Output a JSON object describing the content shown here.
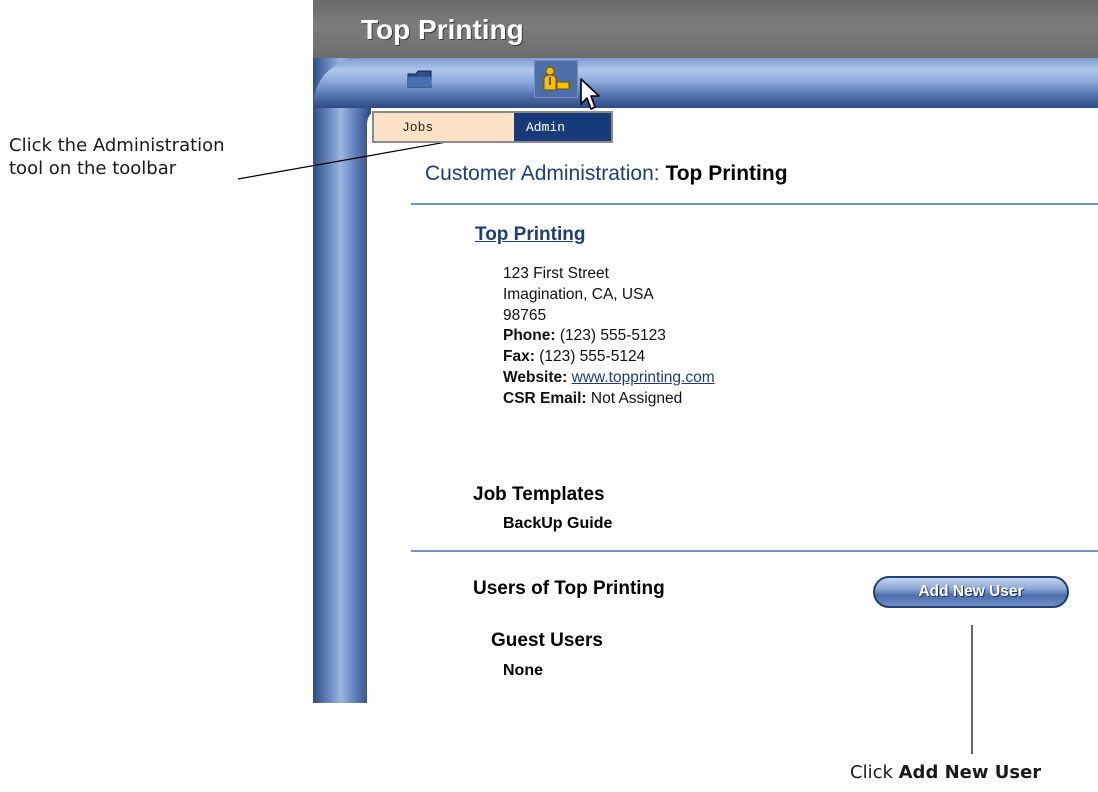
{
  "app": {
    "title": "Top Printing",
    "tabs": [
      {
        "label": "Jobs"
      },
      {
        "label": "Admin"
      }
    ],
    "toolbar": {
      "icons": [
        "folder-icon",
        "admin-icon"
      ]
    }
  },
  "page": {
    "heading_label": "Customer Administration:",
    "heading_company": "Top Printing",
    "company": {
      "name": "Top Printing",
      "address1": "123 First Street",
      "address2": "Imagination, CA, USA",
      "zip": "98765",
      "phone_label": "Phone:",
      "phone": "(123) 555-5123",
      "fax_label": "Fax:",
      "fax": "(123) 555-5124",
      "website_label": "Website:",
      "website": "www.topprinting.com",
      "csr_label": "CSR Email:",
      "csr": "Not Assigned"
    },
    "templates": {
      "title": "Job Templates",
      "items": [
        "BackUp Guide"
      ]
    },
    "users": {
      "title": "Users of Top Printing",
      "add_button": "Add New User",
      "guest_title": "Guest Users",
      "guest_value": "None"
    }
  },
  "annotations": {
    "admin_tool": {
      "text1": "Click the ",
      "bold1": "Administration",
      "text2": "tool on the toolbar"
    },
    "add_user": {
      "text1": "Click ",
      "bold1": "Add New User"
    }
  },
  "colors": {
    "frame_blue": "#4d6ea8",
    "heading_blue": "#1d3e7b",
    "tab_active": "#173b7a",
    "tab_inactive": "#fde1c6",
    "titlebar_gray": "#757575"
  }
}
